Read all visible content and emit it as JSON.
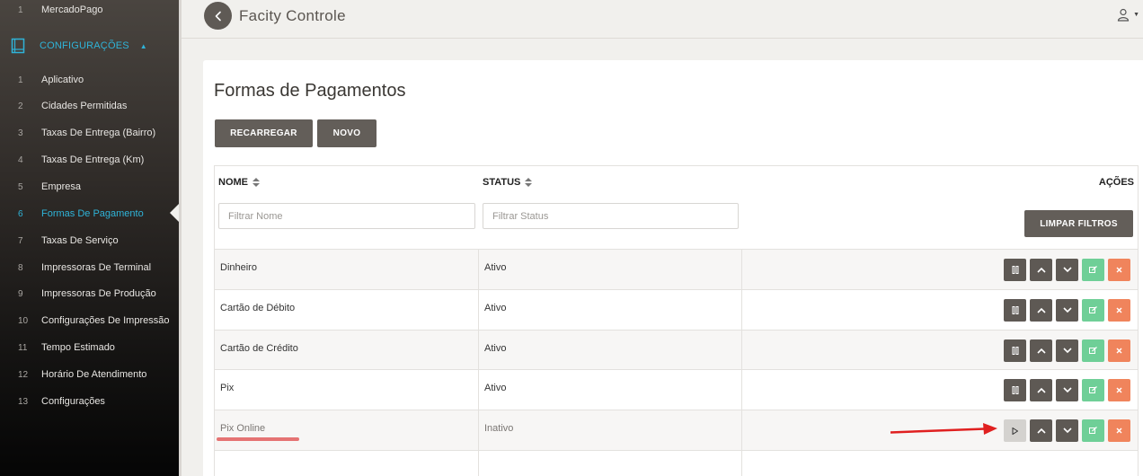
{
  "sidebar": {
    "top_item": {
      "num": "1",
      "label": "MercadoPago"
    },
    "section": {
      "label": "CONFIGURAÇÕES"
    },
    "items": [
      {
        "num": "1",
        "label": "Aplicativo"
      },
      {
        "num": "2",
        "label": "Cidades Permitidas"
      },
      {
        "num": "3",
        "label": "Taxas De Entrega (Bairro)"
      },
      {
        "num": "4",
        "label": "Taxas De Entrega (Km)"
      },
      {
        "num": "5",
        "label": "Empresa"
      },
      {
        "num": "6",
        "label": "Formas De Pagamento"
      },
      {
        "num": "7",
        "label": "Taxas De Serviço"
      },
      {
        "num": "8",
        "label": "Impressoras De Terminal"
      },
      {
        "num": "9",
        "label": "Impressoras De Produção"
      },
      {
        "num": "10",
        "label": "Configurações De Impressão"
      },
      {
        "num": "11",
        "label": "Tempo Estimado"
      },
      {
        "num": "12",
        "label": "Horário De Atendimento"
      },
      {
        "num": "13",
        "label": "Configurações"
      }
    ],
    "accent_color": "#2fb3d8"
  },
  "header": {
    "title": "Facity Controle"
  },
  "page": {
    "title": "Formas de Pagamentos",
    "reload_label": "RECARREGAR",
    "new_label": "NOVO"
  },
  "table": {
    "col_name": "NOME",
    "col_status": "STATUS",
    "col_actions": "AÇÕES",
    "filter_name_placeholder": "Filtrar Nome",
    "filter_status_placeholder": "Filtrar Status",
    "clear_filters_label": "LIMPAR FILTROS",
    "rows": [
      {
        "name": "Dinheiro",
        "status": "Ativo"
      },
      {
        "name": "Cartão de Débito",
        "status": "Ativo"
      },
      {
        "name": "Cartão de Crédito",
        "status": "Ativo"
      },
      {
        "name": "Pix",
        "status": "Ativo"
      },
      {
        "name": "Pix Online",
        "status": "Inativo"
      }
    ]
  },
  "icons": {
    "back": "chevron-left-icon",
    "user": "user-icon",
    "pause": "pause-icon",
    "play": "play-icon",
    "up": "chevron-up-icon",
    "down": "chevron-down-icon",
    "edit": "edit-icon",
    "delete": "close-icon"
  },
  "colors": {
    "dark_button": "#635e59",
    "edit_green": "#6fcf97",
    "delete_orange": "#f0845c",
    "annotation_red": "#e02020"
  }
}
